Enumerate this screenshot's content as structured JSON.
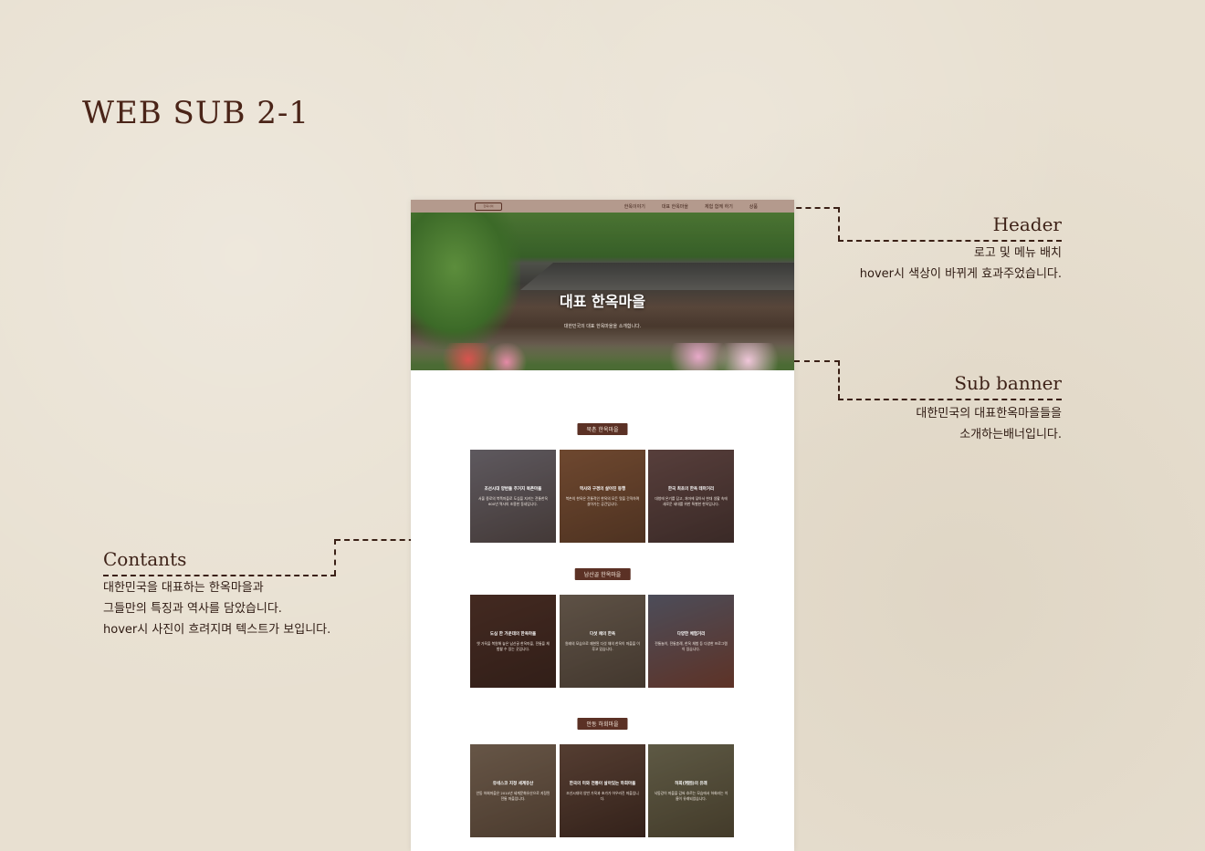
{
  "board": {
    "title": "WEB SUB 2-1"
  },
  "notes": {
    "header": {
      "title": "Header",
      "lines": [
        "로고 및 메뉴 배치",
        "hover시 색상이 바뀌게 효과주었습니다."
      ]
    },
    "sub_banner": {
      "title": "Sub banner",
      "lines": [
        "대한민국의 대표한옥마을들을",
        "소개하는배너입니다."
      ]
    },
    "contents": {
      "title": "Contants",
      "lines": [
        "대한민국을 대표하는 한옥마을과",
        "그들만의 특징과 역사를 담았습니다.",
        "hover시 사진이 흐려지며 텍스트가 보입니다."
      ]
    }
  },
  "page": {
    "logo_text": "한옥사이",
    "nav": [
      "한옥이야기",
      "대표 한옥마을",
      "체험 함께 하기",
      "상품"
    ],
    "banner": {
      "title": "대표 한옥마을",
      "subtitle": "대한민국의 대표 한옥마을을 소개합니다."
    },
    "sections": [
      {
        "label": "북촌 한옥마을",
        "tiles": [
          {
            "title": "조선시대 양반들 주거지 북촌마을",
            "desc": "서울 종로의 북쪽마을로 도심을 지키는 전통한옥 600년 역사의 조용한 동네입니다.",
            "color": "#6b6a6e"
          },
          {
            "title": "역사와 구경의 살아진 동행",
            "desc": "북촌의 한옥은 전통적인 한옥의 모든 멋을 간직하며 살아가는 공간입니다.",
            "color": "#8a5a34"
          },
          {
            "title": "한국 최초의 한옥 테마거리",
            "desc": "대청에 온기를 담고, 처마에 닿아서 현대 생활 속에 새로운 세대를 위한 특별한 한옥입니다.",
            "color": "#6a4f4a"
          }
        ]
      },
      {
        "label": "남산골 한옥마을",
        "tiles": [
          {
            "title": "도심 한 가운데의 한옥마을",
            "desc": "옛 가옥을 복원해 놓은 남산골 한옥마을, 전통을 체험할 수 있는 곳입니다.",
            "color": "#4a3028"
          },
          {
            "title": "다섯 채의 한옥",
            "desc": "원래의 모습으로 재현된 다섯 채의 한옥이 마을을 이루고 있습니다.",
            "color": "#6e6658"
          },
          {
            "title": "다양한 체험거리",
            "desc": "전통놀이, 전통혼례, 한옥 체험 등 다양한 프로그램이 있습니다.",
            "color": "#7a4a3e"
          }
        ]
      },
      {
        "label": "안동 하회마을",
        "tiles": [
          {
            "title": "유네스코 지정 세계유산",
            "desc": "안동 하회마을은 2010년 세계문화유산으로 지정된 전통 마을입니다.",
            "color": "#7a6a58"
          },
          {
            "title": "한국의 미와 전통이 살아있는 하회마을",
            "desc": "조선시대의 양반 가옥과 초가가 어우러진 마을입니다.",
            "color": "#5a4438"
          },
          {
            "title": "하회(河回)의 유래",
            "desc": "낙동강이 마을을 감싸 흐르는 모습에서 하회라는 이름이 유래되었습니다.",
            "color": "#6c6a52"
          }
        ]
      }
    ]
  }
}
